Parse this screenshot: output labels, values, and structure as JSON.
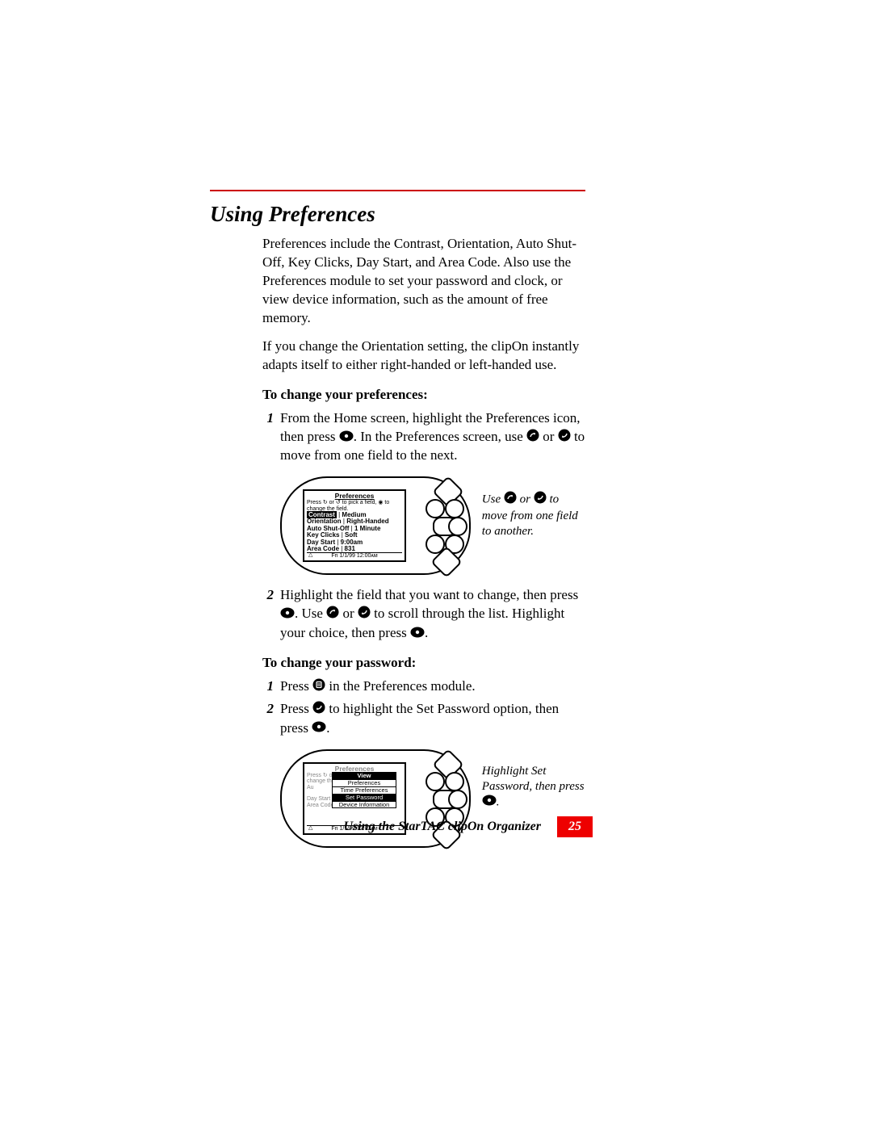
{
  "section_title": "Using Preferences",
  "intro_p1": "Preferences include the Contrast, Orientation, Auto Shut-Off, Key Clicks, Day Start, and Area Code. Also use the Preferences module to set your password and clock, or view device information, such as the amount of free memory.",
  "intro_p2": "If you change the Orientation setting, the clipOn instantly adapts itself to either right-handed or left-handed use.",
  "sub1": "To change your preferences:",
  "s1_step1_a": "From the Home screen, highlight the Preferences icon, then press ",
  "s1_step1_b": ". In the Preferences screen, use ",
  "s1_step1_c": " or ",
  "s1_step1_d": " to move from one field to the next.",
  "fig1_caption_a": "Use ",
  "fig1_caption_b": " or ",
  "fig1_caption_c": " to move from one field to another.",
  "s1_step2_a": "Highlight the field that you want to change, then press ",
  "s1_step2_b": ". Use ",
  "s1_step2_c": " or ",
  "s1_step2_d": " to scroll through the list. Highlight your choice, then press ",
  "s1_step2_e": ".",
  "sub2": "To change your password:",
  "s2_step1_a": "Press ",
  "s2_step1_b": " in the Preferences module.",
  "s2_step2_a": "Press ",
  "s2_step2_b": " to highlight the Set Password option, then press ",
  "s2_step2_c": ".",
  "fig2_caption_a": "Highlight Set Password, then press ",
  "fig2_caption_b": ".",
  "screen1": {
    "title": "Preferences",
    "hint": "Press ↻ or ↺ to pick a field, ◉ to change the field.",
    "rows": [
      {
        "k": "Contrast",
        "v": "Medium",
        "hl": true
      },
      {
        "k": "Orientation",
        "v": "Right-Handed"
      },
      {
        "k": "Auto Shut-Off",
        "v": "1 Minute"
      },
      {
        "k": "Key Clicks",
        "v": "Soft"
      },
      {
        "k": "Day Start",
        "v": "9:00am"
      },
      {
        "k": "Area Code",
        "v": "831"
      }
    ],
    "status": "Fri 1/1/99 12:00ᴀᴍ"
  },
  "screen2": {
    "title": "Preferences",
    "menu_title": "View",
    "menu": [
      "Preferences",
      "Time Preferences",
      "Set Password",
      "Device Information"
    ],
    "menu_hl": 2,
    "status": "Fri 1/1/99 12:02ᴀᴍ"
  },
  "footer_text": "Using the StarTAC clipOn Organizer",
  "page_number": "25"
}
